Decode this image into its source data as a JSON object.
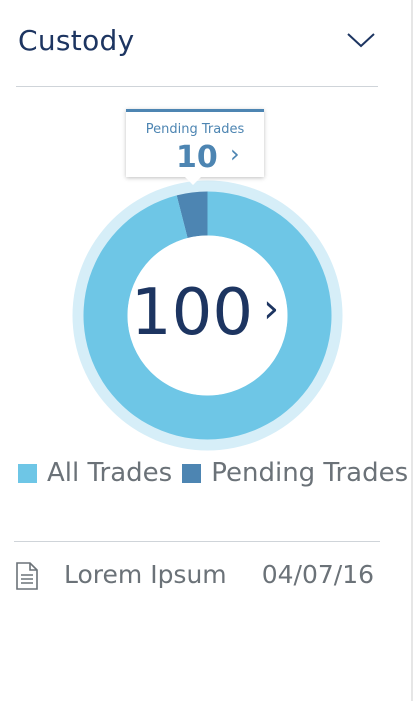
{
  "header": {
    "title": "Custody",
    "chevron_icon": "chevron-down-icon"
  },
  "colors": {
    "all_trades": "#6ec6e6",
    "pending_trades": "#4d85b2",
    "ring_halo": "#d6eef8",
    "text_dark": "#1d3561",
    "text_grey": "#6b7278"
  },
  "tooltip": {
    "label": "Pending Trades",
    "value": "10",
    "arrow": "›"
  },
  "center": {
    "value": "100",
    "arrow": "›"
  },
  "legend": [
    {
      "label": "All Trades"
    },
    {
      "label": "Pending Trades"
    }
  ],
  "chart_data": {
    "type": "pie",
    "categories": [
      "All Trades",
      "Pending Trades"
    ],
    "values": [
      96,
      4
    ],
    "total_label": "100"
  },
  "documents": [
    {
      "name": "Lorem Ipsum",
      "date": "04/07/16",
      "icon": "document-icon"
    }
  ]
}
